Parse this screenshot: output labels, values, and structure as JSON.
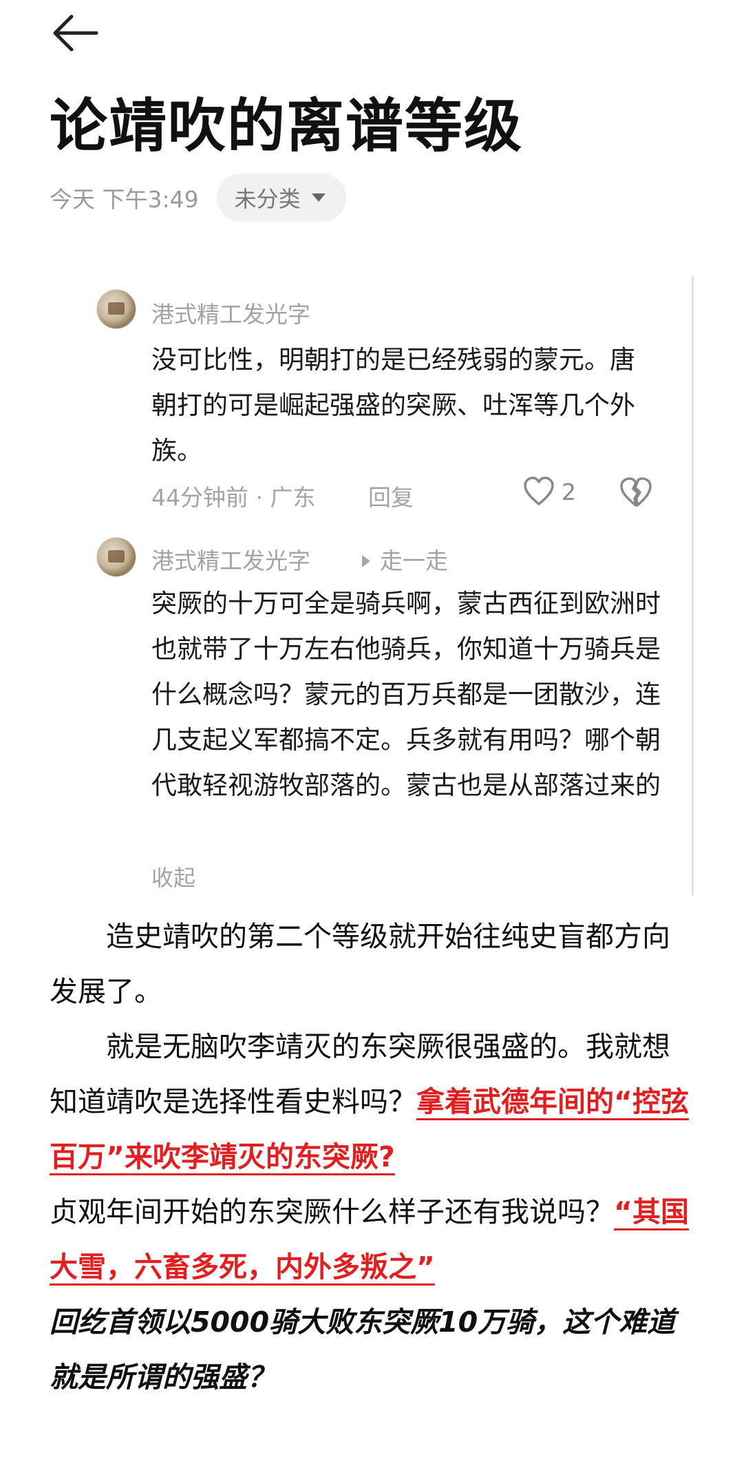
{
  "header": {
    "title": "论靖吹的离谱等级",
    "date": "今天 下午3:49",
    "category": "未分类"
  },
  "comments": [
    {
      "user": "港式精工发光字",
      "text": "没可比性，明朝打的是已经残弱的蒙元。唐朝打的可是崛起强盛的突厥、吐浑等几个外族。",
      "time_location": "44分钟前 · 广东",
      "reply_label": "回复",
      "likes": "2"
    },
    {
      "user": "港式精工发光字",
      "reply_to": "走一走",
      "text": "突厥的十万可全是骑兵啊，蒙古西征到欧洲时也就带了十万左右他骑兵，你知道十万骑兵是什么概念吗？蒙元的百万兵都是一团散沙，连几支起义军都搞不定。兵多就有用吗？哪个朝代敢轻视游牧部落的。蒙古也是从部落过来的",
      "collapse_label": "收起"
    }
  ],
  "article": {
    "p1": "造史靖吹的第二个等级就开始往纯史盲都方向发展了。",
    "p2_a": "就是无脑吹李靖灭的东突厥很强盛的。我就想知道靖吹是选择性看史料吗？",
    "p2_highlight": "拿着武德年间的“控弦百万”来吹李靖灭的东突厥?",
    "p3_a": "贞观年间开始的东突厥什么样子还有我说吗？",
    "p3_highlight": "“其国大雪，六畜多死，内外多叛之”",
    "p4_bold": "回纥首领以5000骑大败东突厥10万骑，这个难道就是所谓的强盛？"
  },
  "colors": {
    "highlight": "#e02020",
    "muted": "#a3a3a3"
  },
  "icons": [
    "arrow-left-icon",
    "caret-down-icon",
    "heart-icon",
    "broken-heart-icon",
    "triangle-right-icon"
  ]
}
